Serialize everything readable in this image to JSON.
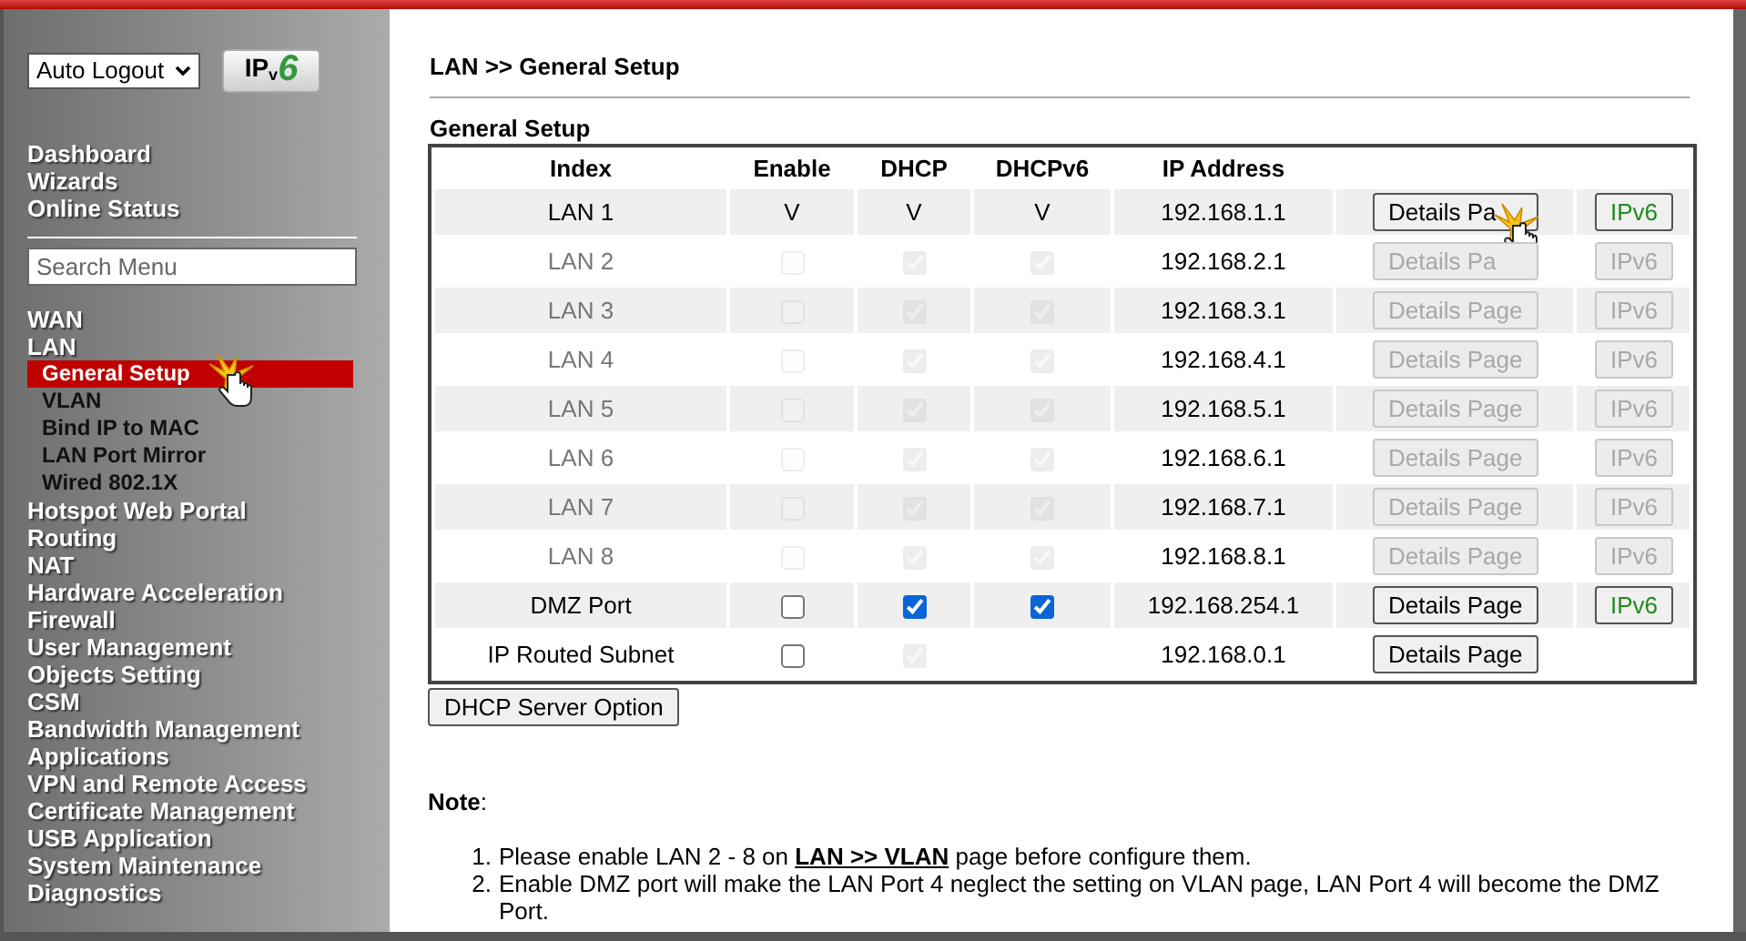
{
  "sidebar": {
    "logout_select": "Auto Logout",
    "ipv6_logo": {
      "ip": "IP",
      "v": "v",
      "six": "6"
    },
    "top_items": [
      "Dashboard",
      "Wizards",
      "Online Status"
    ],
    "search": {
      "placeholder": "Search Menu"
    },
    "items": [
      {
        "label": "WAN"
      },
      {
        "label": "LAN",
        "children": [
          {
            "label": "General Setup",
            "selected": true
          },
          {
            "label": "VLAN",
            "selected": false
          },
          {
            "label": "Bind IP to MAC",
            "selected": false
          },
          {
            "label": "LAN Port Mirror",
            "selected": false
          },
          {
            "label": "Wired 802.1X",
            "selected": false
          }
        ]
      },
      {
        "label": "Hotspot Web Portal"
      },
      {
        "label": "Routing"
      },
      {
        "label": "NAT"
      },
      {
        "label": "Hardware Acceleration"
      },
      {
        "label": "Firewall"
      },
      {
        "label": "User Management"
      },
      {
        "label": "Objects Setting"
      },
      {
        "label": "CSM"
      },
      {
        "label": "Bandwidth Management"
      },
      {
        "label": "Applications"
      },
      {
        "label": "VPN and Remote Access"
      },
      {
        "label": "Certificate Management"
      },
      {
        "label": "USB Application"
      },
      {
        "label": "System Maintenance"
      },
      {
        "label": "Diagnostics"
      }
    ]
  },
  "breadcrumb": "LAN >> General Setup",
  "section_title": "General Setup",
  "table": {
    "columns": [
      "Index",
      "Enable",
      "DHCP",
      "DHCPv6",
      "IP Address"
    ],
    "rows": [
      {
        "index": "LAN 1",
        "disabled": false,
        "enable": {
          "kind": "text",
          "text": "V"
        },
        "dhcp": {
          "kind": "text",
          "text": "V"
        },
        "dhcpv6": {
          "kind": "text",
          "text": "V"
        },
        "ip": "192.168.1.1",
        "details": {
          "label": "Details Pa",
          "disabled": false
        },
        "ipv6": {
          "label": "IPv6",
          "disabled": false
        }
      },
      {
        "index": "LAN 2",
        "disabled": true,
        "enable": {
          "kind": "checkbox",
          "checked": false
        },
        "dhcp": {
          "kind": "checkbox",
          "checked": true
        },
        "dhcpv6": {
          "kind": "checkbox",
          "checked": true
        },
        "ip": "192.168.2.1",
        "details": {
          "label": "Details Pa",
          "disabled": true
        },
        "ipv6": {
          "label": "IPv6",
          "disabled": true
        }
      },
      {
        "index": "LAN 3",
        "disabled": true,
        "enable": {
          "kind": "checkbox",
          "checked": false
        },
        "dhcp": {
          "kind": "checkbox",
          "checked": true
        },
        "dhcpv6": {
          "kind": "checkbox",
          "checked": true
        },
        "ip": "192.168.3.1",
        "details": {
          "label": "Details Page",
          "disabled": true
        },
        "ipv6": {
          "label": "IPv6",
          "disabled": true
        }
      },
      {
        "index": "LAN 4",
        "disabled": true,
        "enable": {
          "kind": "checkbox",
          "checked": false
        },
        "dhcp": {
          "kind": "checkbox",
          "checked": true
        },
        "dhcpv6": {
          "kind": "checkbox",
          "checked": true
        },
        "ip": "192.168.4.1",
        "details": {
          "label": "Details Page",
          "disabled": true
        },
        "ipv6": {
          "label": "IPv6",
          "disabled": true
        }
      },
      {
        "index": "LAN 5",
        "disabled": true,
        "enable": {
          "kind": "checkbox",
          "checked": false
        },
        "dhcp": {
          "kind": "checkbox",
          "checked": true
        },
        "dhcpv6": {
          "kind": "checkbox",
          "checked": true
        },
        "ip": "192.168.5.1",
        "details": {
          "label": "Details Page",
          "disabled": true
        },
        "ipv6": {
          "label": "IPv6",
          "disabled": true
        }
      },
      {
        "index": "LAN 6",
        "disabled": true,
        "enable": {
          "kind": "checkbox",
          "checked": false
        },
        "dhcp": {
          "kind": "checkbox",
          "checked": true
        },
        "dhcpv6": {
          "kind": "checkbox",
          "checked": true
        },
        "ip": "192.168.6.1",
        "details": {
          "label": "Details Page",
          "disabled": true
        },
        "ipv6": {
          "label": "IPv6",
          "disabled": true
        }
      },
      {
        "index": "LAN 7",
        "disabled": true,
        "enable": {
          "kind": "checkbox",
          "checked": false
        },
        "dhcp": {
          "kind": "checkbox",
          "checked": true
        },
        "dhcpv6": {
          "kind": "checkbox",
          "checked": true
        },
        "ip": "192.168.7.1",
        "details": {
          "label": "Details Page",
          "disabled": true
        },
        "ipv6": {
          "label": "IPv6",
          "disabled": true
        }
      },
      {
        "index": "LAN 8",
        "disabled": true,
        "enable": {
          "kind": "checkbox",
          "checked": false
        },
        "dhcp": {
          "kind": "checkbox",
          "checked": true
        },
        "dhcpv6": {
          "kind": "checkbox",
          "checked": true
        },
        "ip": "192.168.8.1",
        "details": {
          "label": "Details Page",
          "disabled": true
        },
        "ipv6": {
          "label": "IPv6",
          "disabled": true
        }
      },
      {
        "index": "DMZ Port",
        "disabled": false,
        "enable": {
          "kind": "checkbox",
          "checked": false
        },
        "dhcp": {
          "kind": "checkbox",
          "checked": true
        },
        "dhcpv6": {
          "kind": "checkbox",
          "checked": true
        },
        "ip": "192.168.254.1",
        "details": {
          "label": "Details Page",
          "disabled": false
        },
        "ipv6": {
          "label": "IPv6",
          "disabled": false
        }
      },
      {
        "index": "IP Routed Subnet",
        "disabled": false,
        "enable": {
          "kind": "checkbox",
          "checked": false
        },
        "dhcp": {
          "kind": "checkbox",
          "checked": true,
          "disabled": true
        },
        "ip": "192.168.0.1",
        "details": {
          "label": "Details Page",
          "disabled": false
        }
      }
    ]
  },
  "dhcp_option_button": "DHCP Server Option",
  "note": {
    "title": "**Note**:",
    "items": [
      {
        "number": "1.",
        "before": "Please enable LAN 2 - 8 on ",
        "link": "LAN >> VLAN",
        "after": " page before configure them."
      },
      {
        "number": "2.",
        "before": "Enable DMZ port will make the LAN Port 4 neglect the setting on VLAN page, LAN Port 4 will become the DMZ Port."
      }
    ]
  }
}
